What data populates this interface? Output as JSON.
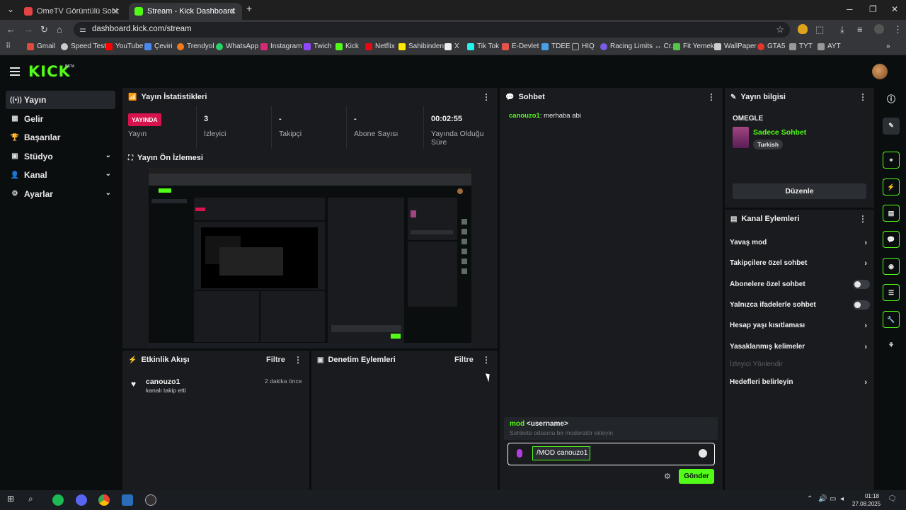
{
  "browser": {
    "tabs": [
      {
        "label": "OmeTV Görüntülü Sohbet",
        "active": false
      },
      {
        "label": "Stream - Kick Dashboard",
        "active": true
      }
    ],
    "url": "dashboard.kick.com/stream",
    "bookmarks": [
      "Gmail",
      "Speed Test",
      "YouTube",
      "Çeviri",
      "Trendyol",
      "WhatsApp",
      "Instagram",
      "Twich",
      "Kick",
      "Netflix",
      "Sahibinden",
      "X",
      "Tik Tok",
      "E-Devlet",
      "TDEE",
      "HIQ",
      "Racing Limits ↔ Cr...",
      "Fit Yemek",
      "WallPaper",
      "GTA5",
      "TYT",
      "AYT"
    ]
  },
  "app": {
    "logo": "KICK",
    "beta": "BETA",
    "nav": [
      {
        "label": "Yayın",
        "icon": "((•))"
      },
      {
        "label": "Gelir",
        "icon": "▦"
      },
      {
        "label": "Başarılar",
        "icon": "🏆"
      },
      {
        "label": "Stüdyo",
        "icon": "▣",
        "chevron": "⌄"
      },
      {
        "label": "Kanal",
        "icon": "👤",
        "chevron": "⌄"
      },
      {
        "label": "Ayarlar",
        "icon": "⚙",
        "chevron": "⌄"
      }
    ]
  },
  "stats": {
    "title": "Yayın İstatistikleri",
    "live_badge": "YAYINDA",
    "live_label": "Yayın",
    "items": [
      {
        "value": "3",
        "label": "İzleyici"
      },
      {
        "value": "-",
        "label": "Takipçi"
      },
      {
        "value": "-",
        "label": "Abone Sayısı"
      },
      {
        "value": "00:02:55",
        "label": "Yayında Olduğu Süre"
      }
    ]
  },
  "preview": {
    "title": "Yayın Ön İzlemesi"
  },
  "activity": {
    "title": "Etkinlik Akışı",
    "filter": "Filtre",
    "events": [
      {
        "user": "canouzo1",
        "action": "kanalı takip etti",
        "time": "2 dakika önce"
      }
    ]
  },
  "moderation": {
    "title": "Denetim Eylemleri",
    "filter": "Filtre"
  },
  "chat": {
    "title": "Sohbet",
    "messages": [
      {
        "user": "canouzo1",
        "text": ": merhaba abi"
      }
    ],
    "suggestion_cmd": "mod",
    "suggestion_arg": "<username>",
    "suggestion_desc": "Sohbete odasına bir moderatör ekleyin",
    "input_value": "/MOD canouzo1",
    "send": "Gönder"
  },
  "stream_info": {
    "title": "Yayın bilgisi",
    "stream_title": "OMEGLE",
    "category": "Sadece Sohbet",
    "tag": "Turkish",
    "edit": "Düzenle"
  },
  "channel_actions": {
    "title": "Kanal Eylemleri",
    "items": [
      {
        "label": "Yavaş mod",
        "control": "arrow"
      },
      {
        "label": "Takipçilere özel sohbet",
        "control": "arrow"
      },
      {
        "label": "Abonelere özel sohbet",
        "control": "toggle",
        "on": false
      },
      {
        "label": "Yalnızca ifadelerle sohbet",
        "control": "toggle",
        "on": false
      },
      {
        "label": "Hesap yaşı kısıtlaması",
        "control": "arrow"
      },
      {
        "label": "Yasaklanmış kelimeler",
        "control": "arrow"
      },
      {
        "label": "İzleyici Yönlendir",
        "control": "none",
        "disabled": true
      },
      {
        "label": "Hedefleri belirleyin",
        "control": "arrow"
      }
    ]
  },
  "taskbar": {
    "time": "01:18",
    "date": "27.08.2025"
  },
  "colors": {
    "accent": "#53fc18",
    "live": "#d6134d",
    "panel": "#191b1f",
    "background": "#0b0e0f"
  }
}
